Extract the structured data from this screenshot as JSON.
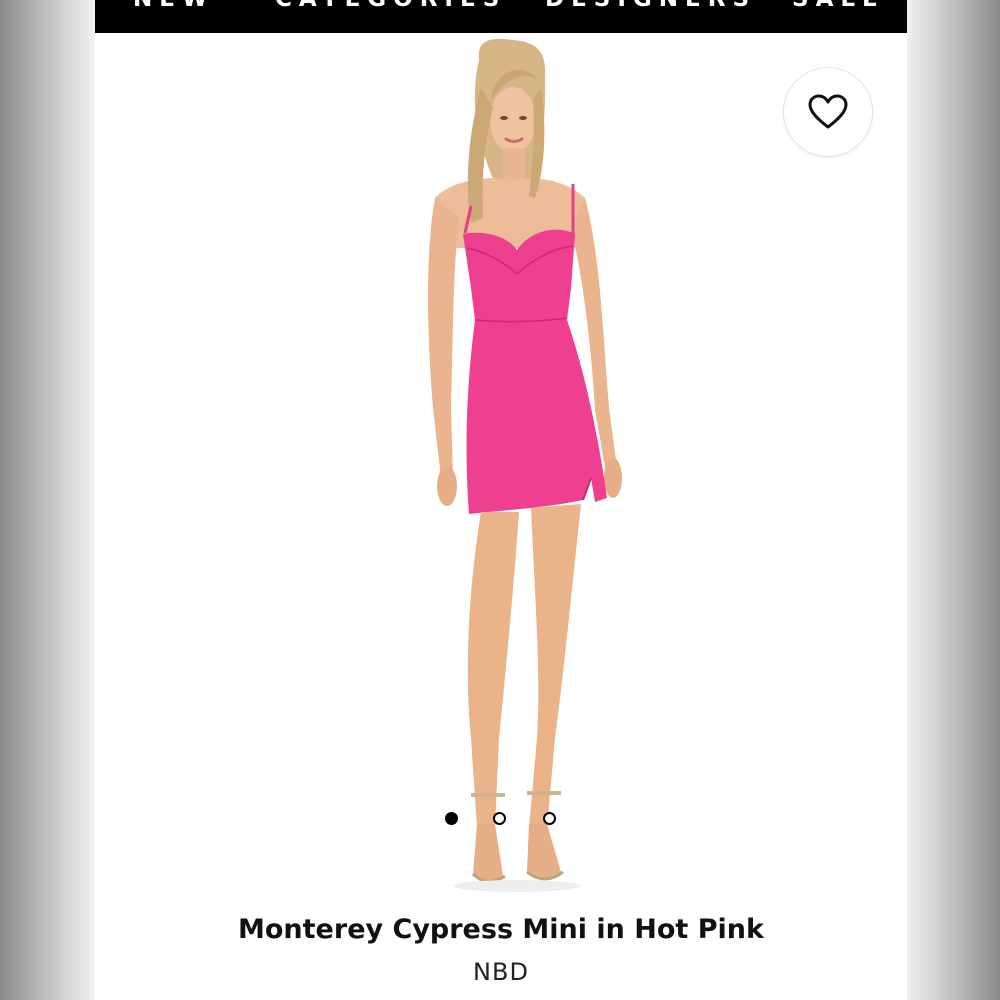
{
  "nav": {
    "items": [
      {
        "label": "NEW"
      },
      {
        "label": "CATEGORIES"
      },
      {
        "label": "DESIGNERS"
      },
      {
        "label": "SALE"
      }
    ]
  },
  "product": {
    "name": "Monterey Cypress Mini in Hot Pink",
    "brand": "NBD",
    "image_icon": "model-wearing-pink-mini-dress",
    "dress_color": "#ef3f8f"
  },
  "gallery": {
    "total": 3,
    "active_index": 0
  },
  "favorite": {
    "icon": "heart-outline-icon"
  }
}
